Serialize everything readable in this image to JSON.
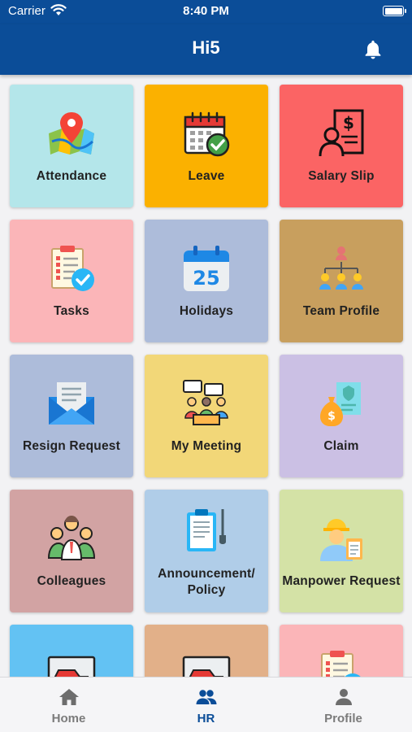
{
  "status_bar": {
    "carrier": "Carrier",
    "time": "8:40 PM"
  },
  "header": {
    "title": "Hi5",
    "notification_icon": "bell-icon"
  },
  "colors": {
    "primary": "#0b4d98",
    "tab_inactive": "#7b7b7b"
  },
  "tiles": [
    {
      "label": "Attendance",
      "icon": "map-pin-icon",
      "color": "#b4e6ea"
    },
    {
      "label": "Leave",
      "icon": "calendar-check-icon",
      "color": "#fbb100"
    },
    {
      "label": "Salary Slip",
      "icon": "salary-document-icon",
      "color": "#fb6464"
    },
    {
      "label": "Tasks",
      "icon": "task-checklist-icon",
      "color": "#fbb5b8"
    },
    {
      "label": "Holidays",
      "icon": "calendar-25-icon",
      "color": "#adbcda"
    },
    {
      "label": "Team Profile",
      "icon": "org-chart-icon",
      "color": "#c89f5e"
    },
    {
      "label": "Resign Request",
      "icon": "envelope-icon",
      "color": "#adbcda"
    },
    {
      "label": "My Meeting",
      "icon": "meeting-icon",
      "color": "#f2d778"
    },
    {
      "label": "Claim",
      "icon": "money-bag-document-icon",
      "color": "#cbc0e4"
    },
    {
      "label": "Colleagues",
      "icon": "group-people-icon",
      "color": "#d2a3a3"
    },
    {
      "label_line1": "Announcement/",
      "label_line2": "Policy",
      "icon": "clipboard-icon",
      "color": "#b0cde8"
    },
    {
      "label": "Manpower Request",
      "icon": "worker-icon",
      "color": "#d4e2a6"
    },
    {
      "label": "",
      "icon": "car-icon",
      "color": "#63c2f3"
    },
    {
      "label": "",
      "icon": "car-icon",
      "color": "#e2b089"
    },
    {
      "label": "",
      "icon": "task-checklist-icon",
      "color": "#fbb5b8"
    }
  ],
  "tabs": [
    {
      "label": "Home",
      "icon": "home-icon",
      "active": false
    },
    {
      "label": "HR",
      "icon": "people-icon",
      "active": true
    },
    {
      "label": "Profile",
      "icon": "person-icon",
      "active": false
    }
  ]
}
